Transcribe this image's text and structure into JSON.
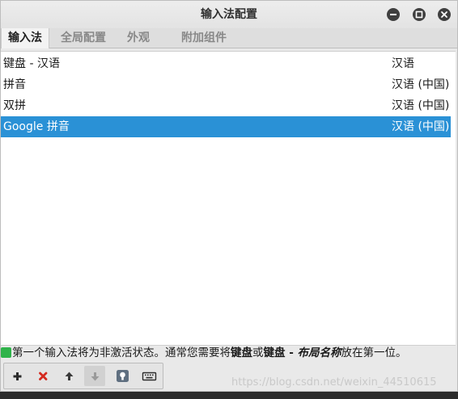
{
  "window": {
    "title": "输入法配置"
  },
  "tabs": [
    {
      "label": "输入法",
      "active": true
    },
    {
      "label": "全局配置",
      "active": false
    },
    {
      "label": "外观",
      "active": false
    },
    {
      "label": "附加组件",
      "active": false
    }
  ],
  "input_methods": [
    {
      "name": "键盘 - 汉语",
      "language": "汉语",
      "selected": false
    },
    {
      "name": "拼音",
      "language": "汉语 (中国)",
      "selected": false
    },
    {
      "name": "双拼",
      "language": "汉语 (中国)",
      "selected": false
    },
    {
      "name": "Google 拼音",
      "language": "汉语 (中国)",
      "selected": true
    }
  ],
  "hint": {
    "part1": "第一个输入法将为非激活状态。通常您需要将",
    "bold1": "键盘",
    "part2": "或",
    "bold2": "键盘 - ",
    "bolditalic": "布局名称",
    "part3": "放在第一位。"
  },
  "toolbar": {
    "buttons": [
      {
        "icon": "add-icon"
      },
      {
        "icon": "remove-icon"
      },
      {
        "icon": "move-up-icon"
      },
      {
        "icon": "move-down-icon"
      },
      {
        "icon": "configure-icon"
      },
      {
        "icon": "keyboard-layout-icon"
      }
    ]
  },
  "watermark": "https://blog.csdn.net/weixin_44510615",
  "colors": {
    "selection": "#2a91d6",
    "window_bg": "#e9e9e9"
  }
}
